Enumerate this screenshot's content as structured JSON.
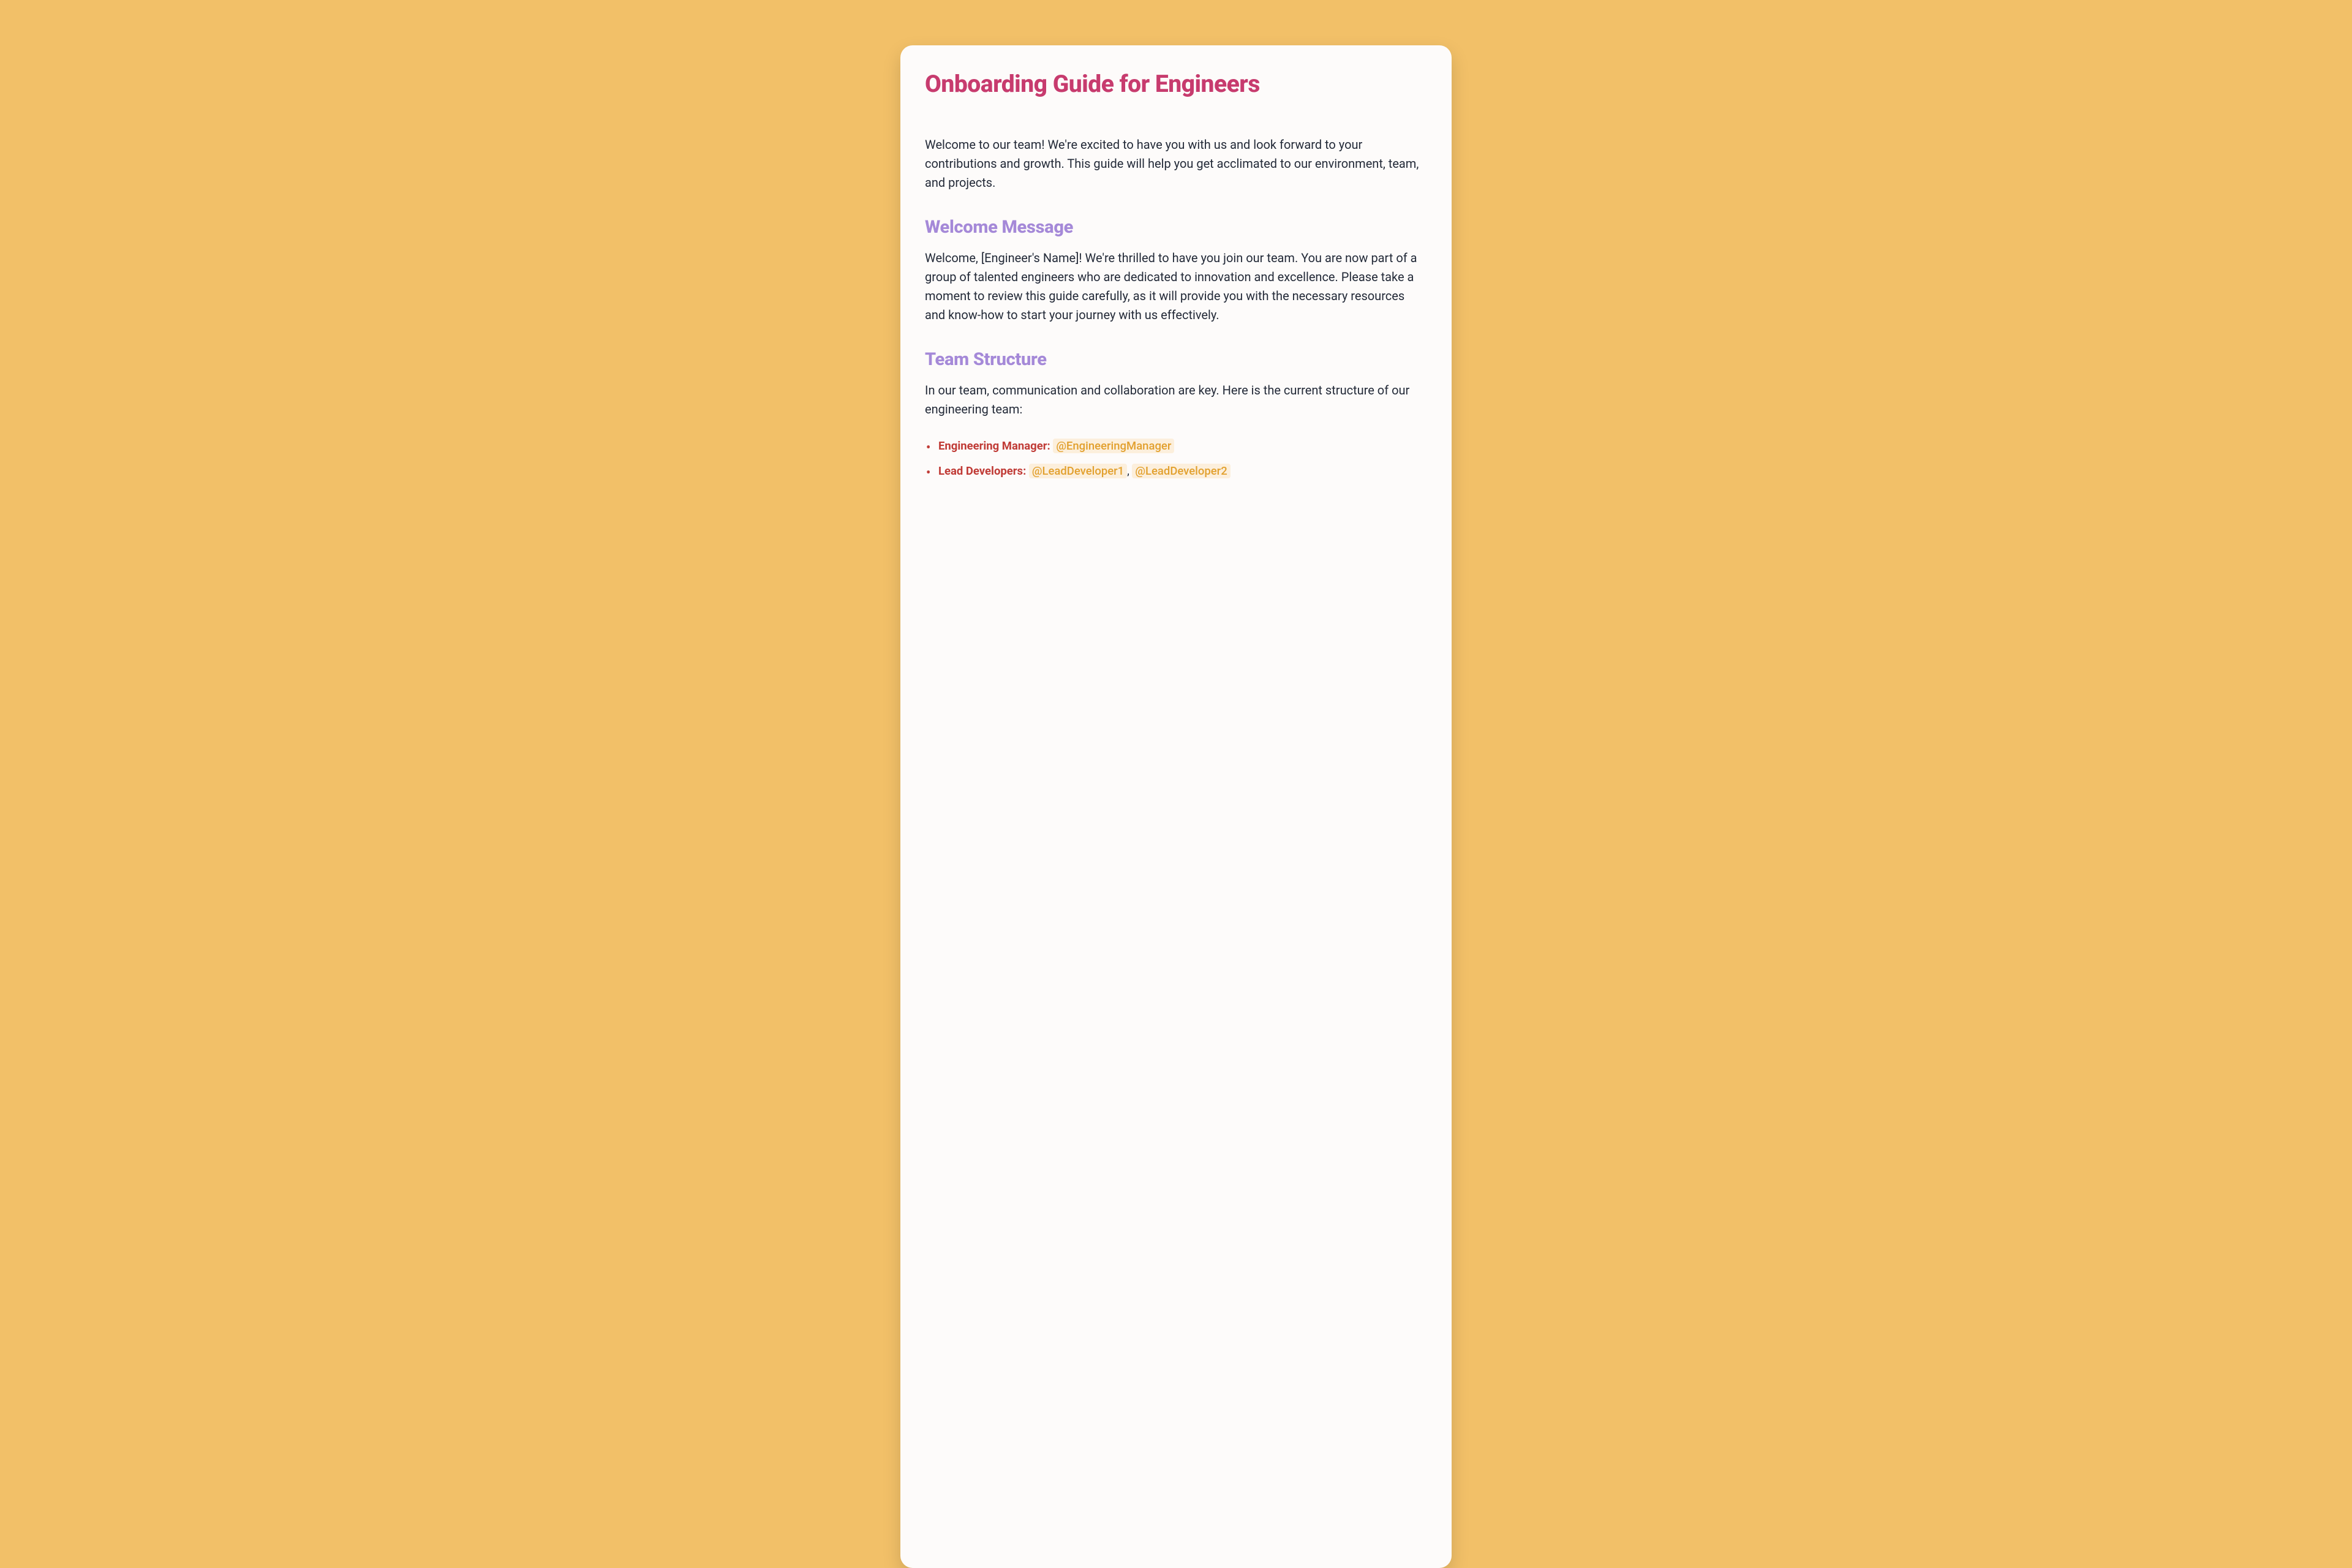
{
  "title": "Onboarding Guide for Engineers",
  "intro": "Welcome to our team! We're excited to have you with us and look forward to your contributions and growth. This guide will help you get acclimated to our environment, team, and projects.",
  "sections": {
    "welcome": {
      "heading": "Welcome Message",
      "body": "Welcome, [Engineer's Name]! We're thrilled to have you join our team. You are now part of a group of talented engineers who are dedicated to innovation and excellence. Please take a moment to review this guide carefully, as it will provide you with the necessary resources and know-how to start your journey with us effectively."
    },
    "team": {
      "heading": "Team Structure",
      "body": "In our team, communication and collaboration are key. Here is the current structure of our engineering team:",
      "roles": [
        {
          "label": "Engineering Manager:",
          "mentions": [
            "@EngineeringManager"
          ]
        },
        {
          "label": "Lead Developers:",
          "mentions": [
            "@LeadDeveloper1",
            "@LeadDeveloper2"
          ]
        }
      ]
    }
  }
}
